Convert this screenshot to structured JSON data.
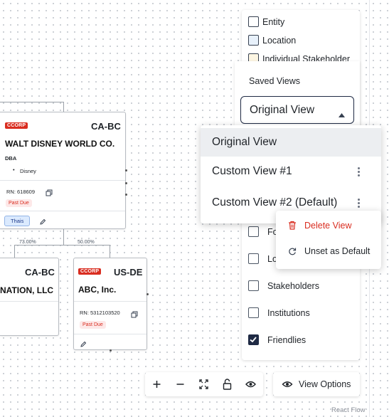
{
  "legend": {
    "items": [
      {
        "label": "Entity",
        "swatch": "#ffffff"
      },
      {
        "label": "Location",
        "swatch": "#e8f1fb"
      },
      {
        "label": "Individual Stakeholder",
        "swatch": "#fdf6e3"
      }
    ]
  },
  "saved_views": {
    "title": "Saved Views",
    "selected": "Original View",
    "options": [
      {
        "label": "Original View",
        "highlighted": true
      },
      {
        "label": "Custom View #1"
      },
      {
        "label": "Custom View #2 (Default)"
      }
    ]
  },
  "context_menu": {
    "delete_label": "Delete View",
    "unset_label": "Unset as Default"
  },
  "filters": [
    {
      "label": "Fo",
      "checked": false
    },
    {
      "label": "Lo",
      "checked": false
    },
    {
      "label": "Stakeholders",
      "checked": false
    },
    {
      "label": "Institutions",
      "checked": false
    },
    {
      "label": "Friendlies",
      "checked": true
    }
  ],
  "nodes": {
    "disney": {
      "badge": "CCORP",
      "code": "CA-BC",
      "name": "WALT DISNEY WORLD CO.",
      "dba_label": "DBA",
      "dba_items": [
        "Disney"
      ],
      "rn": "RN: 618609",
      "status": "Past Due",
      "tag": "Thais"
    },
    "left": {
      "code": "CA-BC",
      "name": "NATION, LLC"
    },
    "abc": {
      "badge": "CCORP",
      "code": "US-DE",
      "name": "ABC, Inc.",
      "rn": "RN: 5312103520",
      "status": "Past Due"
    }
  },
  "edges": {
    "left_pct": "73.00%",
    "right_pct": "50.00%"
  },
  "controls": {
    "view_options_label": "View Options"
  },
  "attribution": "React Flow",
  "colors": {
    "danger": "#d92d20",
    "tag_bg": "#dbeafe",
    "checked": "#1f2a44"
  }
}
